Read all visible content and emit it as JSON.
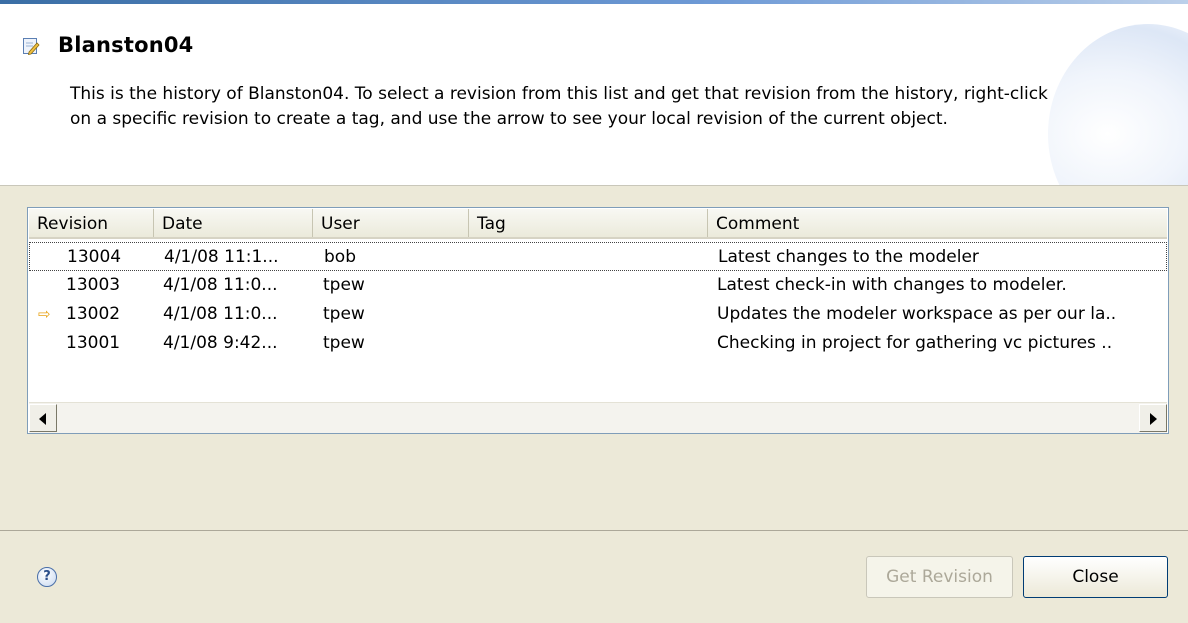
{
  "dialog": {
    "title": "Blanston04",
    "description": "This is the history of Blanston04.  To select a revision from this list and get that revision from the history, right-click on a specific revision to create a tag, and use the arrow to see your local revision of the current object.",
    "icon": "edit-document-icon"
  },
  "table": {
    "columns": [
      "Revision",
      "Date",
      "User",
      "Tag",
      "Comment"
    ],
    "rows": [
      {
        "revision": "13004",
        "date": "4/1/08 11:1...",
        "user": "bob",
        "tag": "",
        "comment": "Latest changes to the modeler",
        "selected": true
      },
      {
        "revision": "13003",
        "date": "4/1/08 11:0...",
        "user": "tpew",
        "tag": "",
        "comment": "Latest check-in with changes to modeler."
      },
      {
        "revision": "13002",
        "date": "4/1/08 11:0...",
        "user": "tpew",
        "tag": "",
        "comment": "Updates the modeler workspace as per our la..",
        "current": true
      },
      {
        "revision": "13001",
        "date": "4/1/08 9:42...",
        "user": "tpew",
        "tag": "",
        "comment": "Checking in project for gathering vc pictures .."
      }
    ]
  },
  "footer": {
    "help_icon": "help-icon",
    "get_revision_label": "Get Revision",
    "close_label": "Close"
  },
  "colors": {
    "accent": "#3a6ea5",
    "current_arrow": "#e8a317",
    "dialog_bg": "#ece9d8"
  }
}
